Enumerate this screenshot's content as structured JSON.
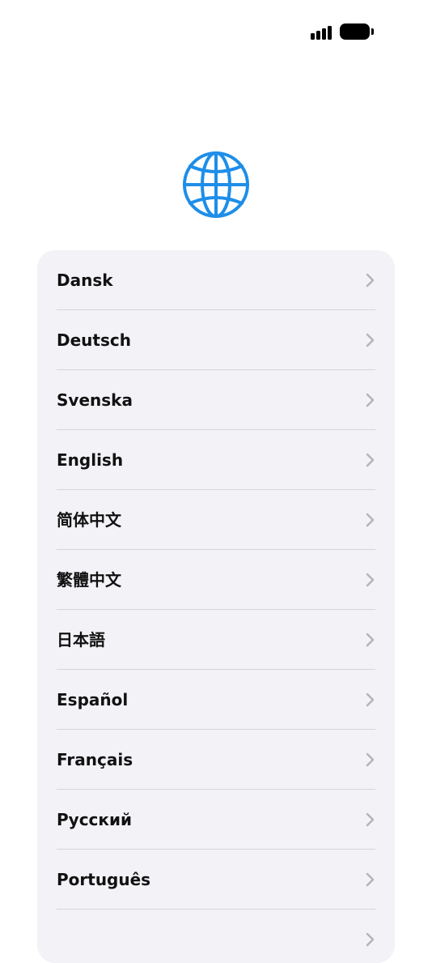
{
  "status_bar": {
    "signal_icon": "cellular-signal-icon",
    "battery_icon": "battery-icon"
  },
  "header": {
    "icon": "globe-icon",
    "accent_color": "#1e8ee8"
  },
  "language_list": {
    "items": [
      {
        "label": "Dansk"
      },
      {
        "label": "Deutsch"
      },
      {
        "label": "Svenska"
      },
      {
        "label": "English"
      },
      {
        "label": "简体中文"
      },
      {
        "label": "繁體中文"
      },
      {
        "label": "日本語"
      },
      {
        "label": "Español"
      },
      {
        "label": "Français"
      },
      {
        "label": "Русский"
      },
      {
        "label": "Português"
      },
      {
        "label": ""
      }
    ],
    "chevron_icon": "chevron-right-icon",
    "background_color": "#f2f2f7"
  }
}
